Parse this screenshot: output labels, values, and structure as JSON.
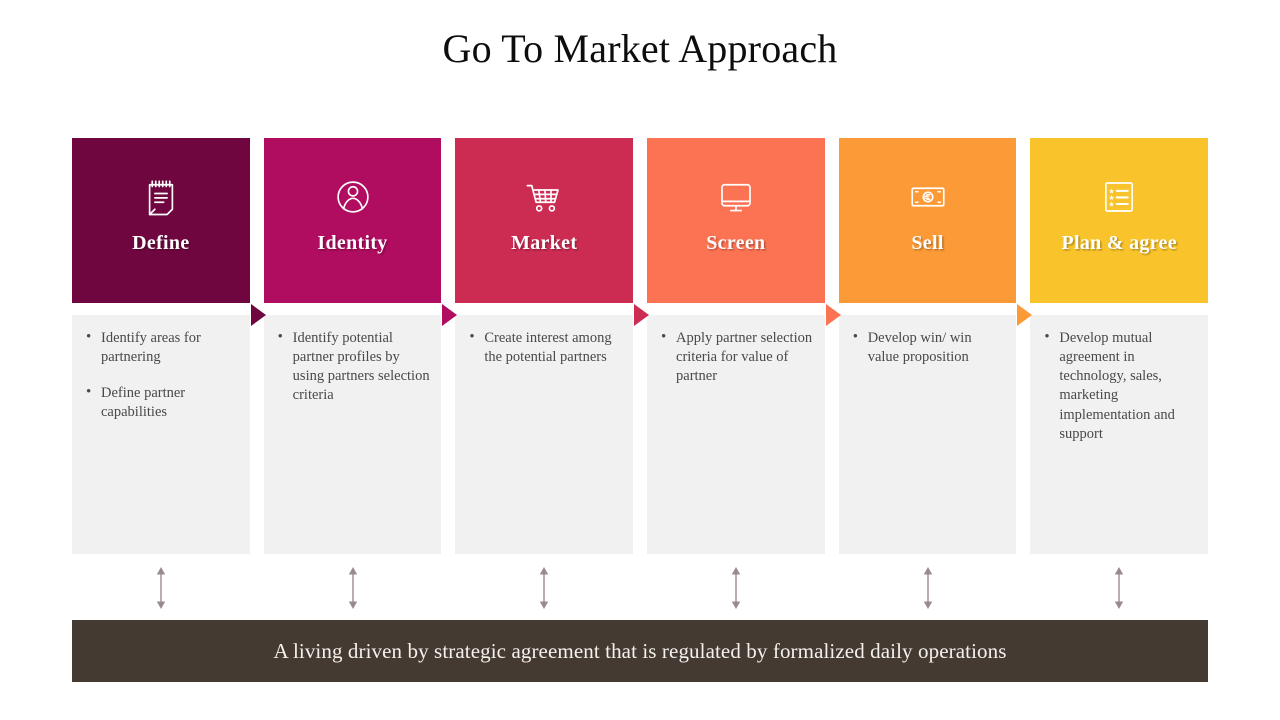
{
  "title": "Go To Market Approach",
  "columns": [
    {
      "label": "Define",
      "color": "#70063f",
      "icon": "notepad-icon",
      "bullets": [
        "Identify areas for partnering",
        "Define partner capabilities"
      ],
      "connector_color": "#70063f"
    },
    {
      "label": "Identity",
      "color": "#b00c60",
      "icon": "user-circle-icon",
      "bullets": [
        "Identify potential partner profiles by using partners selection criteria"
      ],
      "connector_color": "#b00c60"
    },
    {
      "label": "Market",
      "color": "#cc2c52",
      "icon": "shopping-cart-icon",
      "bullets": [
        "Create interest among the potential partners"
      ],
      "connector_color": "#cc2c52"
    },
    {
      "label": "Screen",
      "color": "#fc7354",
      "icon": "monitor-icon",
      "bullets": [
        "Apply partner selection criteria for value of partner"
      ],
      "connector_color": "#fc7354"
    },
    {
      "label": "Sell",
      "color": "#fb9a37",
      "icon": "banknote-euro-icon",
      "bullets": [
        "Develop win/ win value proposition"
      ],
      "connector_color": "#fb9a37"
    },
    {
      "label": "Plan & agree",
      "color": "#f9c32b",
      "icon": "star-checklist-icon",
      "bullets": [
        "Develop mutual agreement in technology, sales, marketing implementation and support"
      ],
      "connector_color": ""
    }
  ],
  "arrow_color": "#9a8b8e",
  "footer": {
    "text": "A living driven by strategic agreement that is regulated by formalized daily operations",
    "background": "#453a31",
    "text_color": "#f4f1ee"
  }
}
